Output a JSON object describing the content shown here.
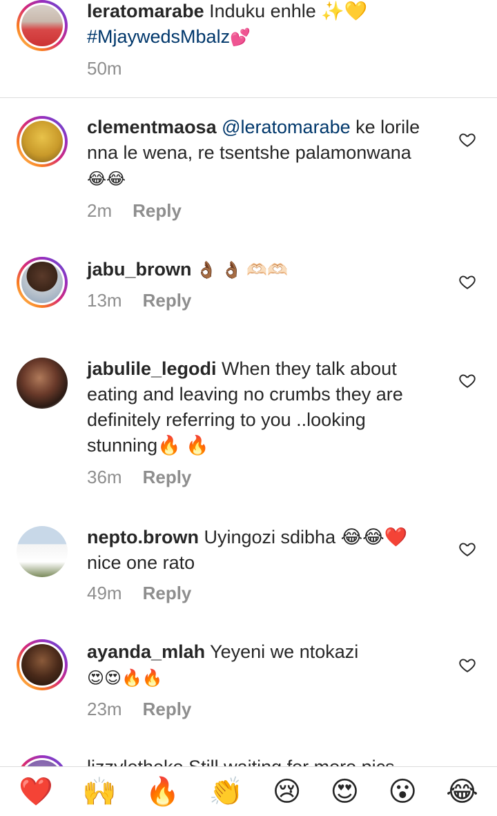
{
  "caption": {
    "username": "leratomarabe",
    "text": "Induku enhle ✨💛",
    "hashtag": "#MjaywedsMbalz",
    "hashtag_emoji": "💕",
    "time": "50m"
  },
  "comments": [
    {
      "username": "clementmaosa",
      "mention": "@leratomarabe",
      "line1": " ke lorile",
      "line2": "nna le wena, re tsentshe palamonwana",
      "emoji": "😂😂",
      "time": "2m",
      "reply": "Reply"
    },
    {
      "username": "jabu_brown",
      "text": " 👌🏾 👌🏾 🫶🏻🫶🏻",
      "time": "13m",
      "reply": "Reply"
    },
    {
      "username": "jabulile_legodi",
      "line1": " When they talk about",
      "line2": "eating and leaving no crumbs they are",
      "line3": "definitely referring to you ..looking",
      "line4": "stunning🔥 🔥",
      "time": "36m",
      "reply": "Reply"
    },
    {
      "username": "nepto.brown",
      "line1": " Uyingozi sdibha 😂😂❤️",
      "line2": "nice one rato",
      "time": "49m",
      "reply": "Reply"
    },
    {
      "username": "ayanda_mlah",
      "line1": " Yeyeni we ntokazi",
      "emoji": "😍😍🔥🔥",
      "time": "23m",
      "reply": "Reply"
    }
  ],
  "partial_comment": "lizzyletheko Still waiting for more pics",
  "reactions": [
    "❤️",
    "🙌",
    "🔥",
    "👏",
    "😢",
    "😍",
    "😮",
    "😂"
  ]
}
